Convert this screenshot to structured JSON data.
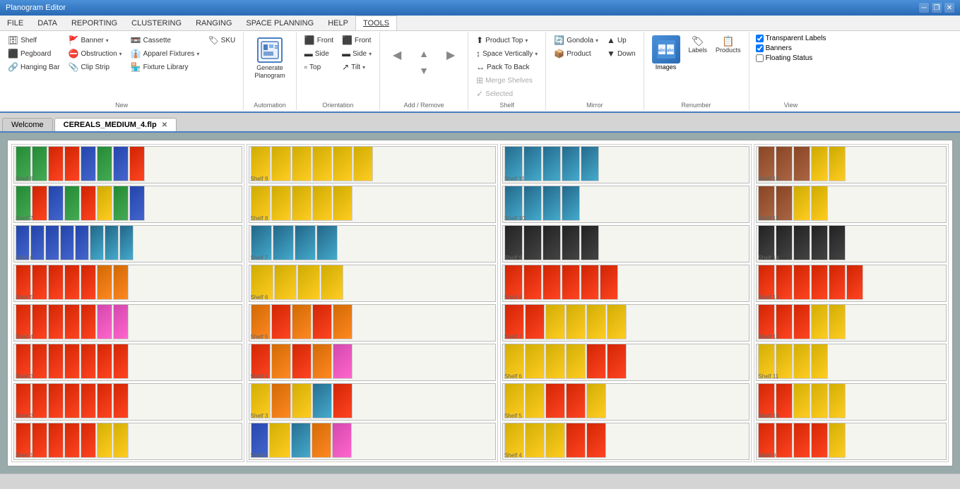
{
  "titlebar": {
    "title": "Planogram Editor"
  },
  "menubar": {
    "items": [
      "FILE",
      "DATA",
      "REPORTING",
      "CLUSTERING",
      "RANGING",
      "SPACE PLANNING",
      "HELP",
      "TOOLS"
    ]
  },
  "ribbon": {
    "groups": {
      "new": {
        "label": "New",
        "items": [
          "Shelf",
          "Pegboard",
          "Hanging Bar",
          "Banner",
          "Obstruction",
          "Clip Strip",
          "Cassette",
          "Apparel Fixtures",
          "Fixture Library",
          "SKU"
        ]
      },
      "automation": {
        "label": "Automation",
        "generate_label": "Generate\nPlanogram"
      },
      "orientation": {
        "label": "Orientation",
        "items": [
          "Front",
          "Side",
          "Top",
          "Front",
          "Side",
          "Top",
          "Tilt"
        ]
      },
      "addremove": {
        "label": "Add / Remove",
        "items": []
      },
      "shelf": {
        "label": "Shelf",
        "items": [
          "Product Top",
          "Space Vertically",
          "Pack To Back",
          "Merge Shelves",
          "Selected"
        ]
      },
      "mirror": {
        "label": "Mirror",
        "items": [
          "Gondola",
          "Product",
          "Up",
          "Down"
        ]
      },
      "renumber": {
        "label": "Renumber",
        "images_label": "Images",
        "labels_label": "Labels",
        "products_label": "Products"
      },
      "view": {
        "label": "View",
        "items": [
          "Transparent Labels",
          "Banners",
          "Floating Status"
        ]
      }
    }
  },
  "tabs": [
    {
      "id": "welcome",
      "label": "Welcome",
      "closeable": false,
      "active": false
    },
    {
      "id": "cereals",
      "label": "CEREALS_MEDIUM_4.flp",
      "closeable": true,
      "active": true
    }
  ],
  "shelves": [
    {
      "label": "Shelf 8",
      "rows": 8
    },
    {
      "label": "Shelf 7",
      "rows": 7
    },
    {
      "label": "Shelf 6",
      "rows": 6
    },
    {
      "label": "Shelf 5",
      "rows": 5
    },
    {
      "label": "Shelf 4",
      "rows": 4
    },
    {
      "label": "Shelf 3",
      "rows": 3
    },
    {
      "label": "Shelf 2",
      "rows": 2
    },
    {
      "label": "Shelf 1",
      "rows": 1
    }
  ],
  "statusbar": {
    "text": ""
  },
  "controls": {
    "minimize": "─",
    "restore": "❐",
    "close": "✕"
  },
  "icons": {
    "shelf": "🗄",
    "pegboard": "⬛",
    "hangingbar": "🔗",
    "banner": "🚩",
    "cassette": "📼",
    "apparel": "👔",
    "fixture": "🏪",
    "sku": "🏷",
    "obstruction": "⛔",
    "clipstrip": "📎",
    "generate": "⚡",
    "front": "⬛",
    "side": "▬",
    "top": "▫",
    "tilt": "↗",
    "add": "➕",
    "remove": "➖",
    "producttop": "⬆",
    "spacevert": "↕",
    "packback": "↔",
    "merge": "⊞",
    "selected": "✓",
    "gondola": "🔄",
    "product": "📦",
    "up": "▲",
    "down": "▼",
    "images": "🖼",
    "labels": "🏷",
    "products": "📋"
  }
}
